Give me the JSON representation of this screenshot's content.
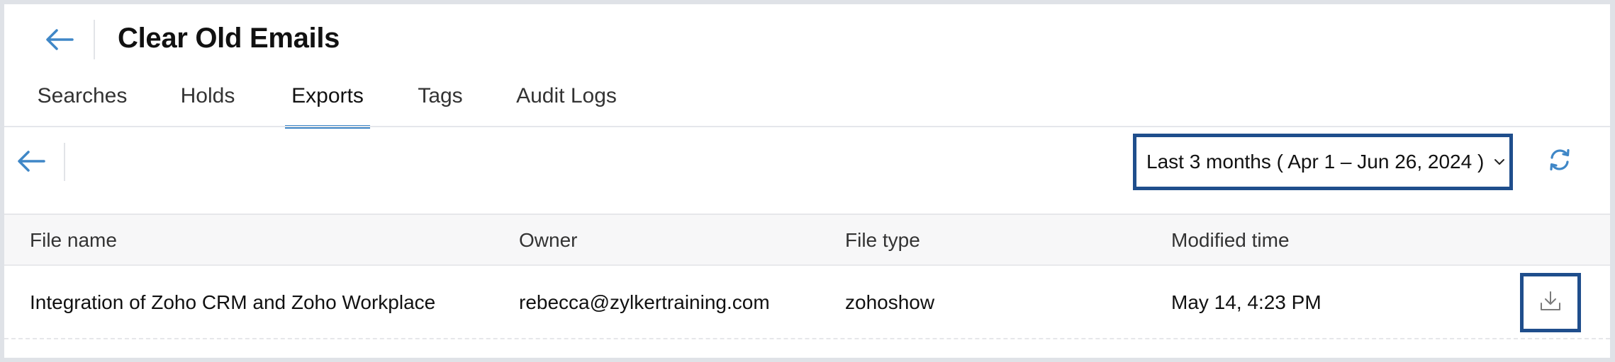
{
  "header": {
    "title": "Clear Old Emails",
    "back_icon": "arrow-left-icon"
  },
  "tabs": [
    {
      "label": "Searches",
      "active": false
    },
    {
      "label": "Holds",
      "active": false
    },
    {
      "label": "Exports",
      "active": true
    },
    {
      "label": "Tags",
      "active": false
    },
    {
      "label": "Audit Logs",
      "active": false
    }
  ],
  "toolbar": {
    "back_icon": "arrow-left-icon",
    "date_range": "Last 3 months ( Apr 1 – Jun 26, 2024 )",
    "dropdown_icon": "chevron-down-icon",
    "refresh_icon": "refresh-icon"
  },
  "table": {
    "columns": [
      "File name",
      "Owner",
      "File type",
      "Modified time"
    ],
    "rows": [
      {
        "file_name": "Integration of Zoho CRM and Zoho Workplace",
        "owner": "rebecca@zylkertraining.com",
        "file_type": "zohoshow",
        "modified_time": "May 14, 4:23 PM",
        "action_icon": "download-icon"
      }
    ]
  },
  "colors": {
    "accent": "#3f87c7",
    "highlight_border": "#1f4e8c",
    "header_bg": "#f7f7f8"
  }
}
